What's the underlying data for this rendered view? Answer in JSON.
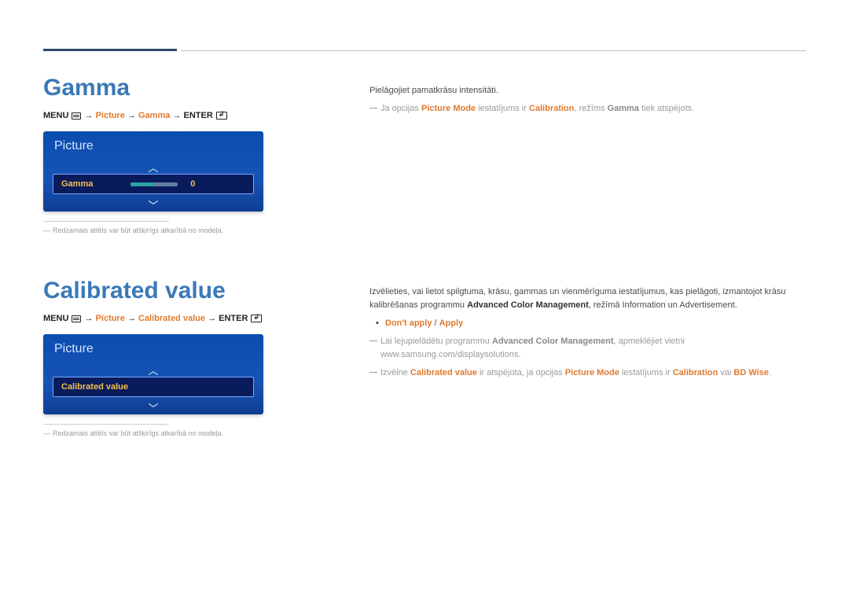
{
  "header": {
    "accent": true
  },
  "gamma": {
    "heading": "Gamma",
    "breadcrumb": {
      "menu": "MENU",
      "arrow": " → ",
      "picture": "Picture",
      "gamma": "Gamma",
      "enter": "ENTER"
    },
    "panel": {
      "title": "Picture",
      "item_label": "Gamma",
      "item_value": "0"
    },
    "panel_footnote": "Redzamais attēls var būt atšķirīgs atkarībā no modeļa.",
    "right": {
      "line1": "Pielāgojiet pamatkrāsu intensitāti.",
      "note_prefix": "Ja opcijas ",
      "note_pm": "Picture Mode",
      "note_mid": " iestatījums ir ",
      "note_cal": "Calibration",
      "note_mid2": ", režīms ",
      "note_gamma": "Gamma",
      "note_suffix": " tiek atspējots."
    }
  },
  "calibrated": {
    "heading": "Calibrated value",
    "breadcrumb": {
      "menu": "MENU",
      "arrow": " → ",
      "picture": "Picture",
      "cal": "Calibrated value",
      "enter": "ENTER"
    },
    "panel": {
      "title": "Picture",
      "item_label": "Calibrated value"
    },
    "panel_footnote": "Redzamais attēls var būt atšķirīgs atkarībā no modeļa.",
    "right": {
      "para_a": "Izvēlieties, vai lietot spilgtuma, krāsu, gammas un vienmērīguma iestatījumus, kas pielāgoti, izmantojot krāsu kalibrēšanas programmu ",
      "para_acm": "Advanced Color Management",
      "para_b": ", režīmā Information un Advertisement.",
      "bullet_dontapply": "Don't apply",
      "bullet_sep": " / ",
      "bullet_apply": "Apply",
      "note2_a": "Lai lejupielādētu programmu ",
      "note2_acm": "Advanced Color Management",
      "note2_b": ", apmeklējiet vietni www.samsung.com/displaysolutions.",
      "note3_a": "Izvēlne ",
      "note3_cv": "Calibrated value",
      "note3_b": " ir atspējota, ja opcijas ",
      "note3_pm": "Picture Mode",
      "note3_c": " iestatījums ir ",
      "note3_cal": "Calibration",
      "note3_d": " vai ",
      "note3_bd": "BD Wise",
      "note3_e": "."
    }
  }
}
